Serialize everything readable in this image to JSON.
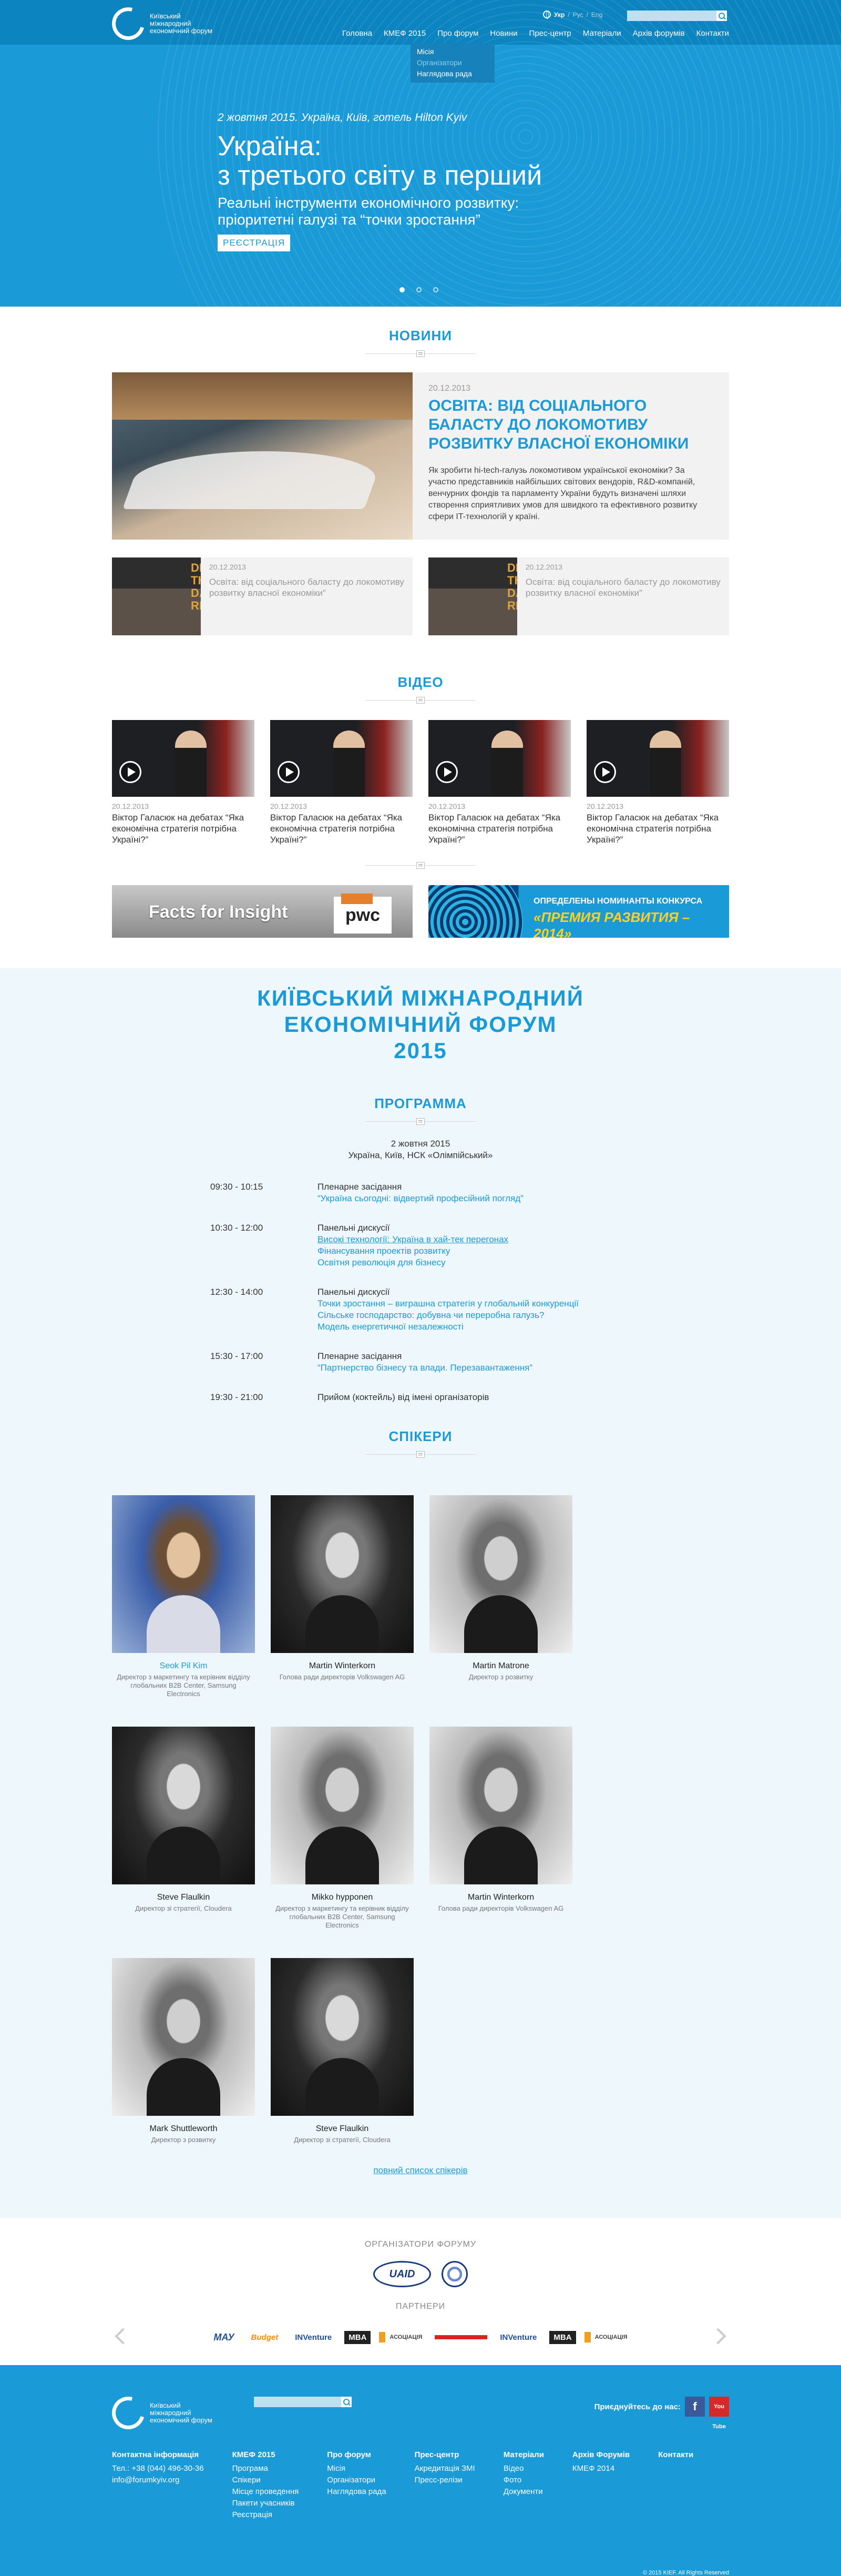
{
  "header": {
    "logo_text": "Київський міжнародний економічний форум",
    "lang_active": "Укр",
    "lang_sep": "/",
    "lang_ru": "Рус",
    "lang_en": "Eng",
    "search_placeholder": "",
    "nav": [
      "Головна",
      "КМЕФ 2015",
      "Про форум",
      "Новини",
      "Прес-центр",
      "Матеріали",
      "Архів форумів",
      "Контакти"
    ],
    "submenu": [
      "Місія",
      "Організатори",
      "Наглядова рада"
    ]
  },
  "hero": {
    "date": "2 жовтня 2015. Україна, Київ, готель Hilton Kyiv",
    "title_1": "Україна:",
    "title_2": "з третього світу в перший",
    "subtitle_1": "Реальні інструменти економічного розвитку:",
    "subtitle_2": "пріоритетні галузі та “точки зростання”",
    "button": "РЕЄСТРАЦІЯ",
    "slides_total": 3,
    "slide_active": 1
  },
  "news": {
    "heading": "НОВИНИ",
    "featured": {
      "date": "20.12.2013",
      "title": "ОСВІТА: ВІД СОЦІАЛЬНОГО БАЛАСТУ ДО ЛОКОМОТИВУ РОЗВИТКУ ВЛАСНОЇ ЕКОНОМІКИ",
      "text": "Як зробити hi-tech-галузь локомотивом української економіки? За участю представників найбільших світових вендорів, R&D-компаній, венчурних фондів та парламенту України будуть визначені шляхи створення сприятливих умов для швидкого та ефективного розвитку сфери IT-технологій у країні."
    },
    "items": [
      {
        "date": "20.12.2013",
        "title": "Освіта: від соціального баласту до локомотиву розвитку власної економіки”",
        "image_text": "DRIVING THE DATA RE"
      },
      {
        "date": "20.12.2013",
        "title": "Освіта: від соціального баласту до локомотиву розвитку власної економіки”",
        "image_text": "DRIVING THE DATA RE"
      }
    ]
  },
  "video": {
    "heading": "ВІДЕО",
    "items": [
      {
        "date": "20.12.2013",
        "title": "Віктор Галасюк на дебатах “Яка економічна стратегія потрібна Україні?”"
      },
      {
        "date": "20.12.2013",
        "title": "Віктор Галасюк на дебатах “Яка економічна стратегія потрібна Україні?”"
      },
      {
        "date": "20.12.2013",
        "title": "Віктор Галасюк на дебатах “Яка економічна стратегія потрібна Україні?”"
      },
      {
        "date": "20.12.2013",
        "title": "Віктор Галасюк на дебатах “Яка економічна стратегія потрібна Україні?”"
      }
    ]
  },
  "banners": {
    "b1_text": "Facts for Insight",
    "b1_logo": "pwc",
    "b2_line1": "ОПРЕДЕЛЕНЫ НОМИНАНТЫ КОНКУРСА",
    "b2_line2": "«ПРЕМИЯ РАЗВИТИЯ – 2014»"
  },
  "forum": {
    "title_1": "КИЇВСЬКИЙ МІЖНАРОДНИЙ",
    "title_2": "ЕКОНОМІЧНИЙ ФОРУМ",
    "year": "2015",
    "program_heading": "ПРОГРАММА",
    "program_date": "2 жовтня 2015",
    "program_place": "Україна, Київ, НСК «Олімпійський»",
    "program": [
      {
        "time": "09:30 - 10:15",
        "kind": "Пленарне засідання",
        "links": [
          "“Україна сьогодні: відвертий професійний погляд”"
        ]
      },
      {
        "time": "10:30 - 12:00",
        "kind": "Панельні дискусії",
        "links": [
          "Високі технології: Україна в хай-тек перегонах",
          "Фінансування проектів розвитку",
          "Освітня революція для бізнесу"
        ]
      },
      {
        "time": "12:30 - 14:00",
        "kind": "Панельні дискусії",
        "links": [
          "Точки зростання – виграшна стратегія у глобальній конкуренції",
          "Сільське господарство: добувна чи переробна галузь?",
          "Модель енергетичної незалежності"
        ]
      },
      {
        "time": "15:30 - 17:00",
        "kind": "Пленарне засідання",
        "links": [
          "“Партнерство бізнесу та влади. Перезавантаження”"
        ]
      },
      {
        "time": "19:30 - 21:00",
        "kind": "Прийом (коктейль) від імені організаторів",
        "links": []
      }
    ],
    "speakers_heading": "СПІКЕРИ",
    "speakers": [
      {
        "name": "Seok Pil Kim",
        "role": "Директор з маркетингу та керівник відділу глобальних B2B Center, Samsung Electronics"
      },
      {
        "name": "Martin Winterkorn",
        "role": "Голова ради директорів Volkswagen AG"
      },
      {
        "name": "Martin Matrone",
        "role": "Директор з розвитку"
      },
      {
        "name": "Steve Flaulkin",
        "role": "Директор зі стратегії, Cloudera"
      },
      {
        "name": "Mikko hypponen",
        "role": "Директор з маркетингу та керівник відділу глобальних B2B Center, Samsung Electronics"
      },
      {
        "name": "Martin Winterkorn",
        "role": "Голова ради директорів Volkswagen AG"
      },
      {
        "name": "Mark Shuttleworth",
        "role": "Директор з розвитку"
      },
      {
        "name": "Steve Flaulkin",
        "role": "Директор зі стратегії, Cloudera"
      }
    ],
    "full_list": "повний список спікерів"
  },
  "orgs": {
    "heading": "ОРГАНІЗАТОРИ ФОРУМУ",
    "uaid": "UAID",
    "partners_heading": "ПАРТНЕРИ",
    "partners": [
      "МАУ",
      "Budget",
      "INVenture",
      "MBA",
      "АСОЦІАЦІЯ",
      "",
      "INVenture",
      "MBA",
      "АСОЦІАЦІЯ"
    ]
  },
  "footer": {
    "logo_text": "Київський міжнародний економічний форум",
    "join": "Приєднуйтесь до нас:",
    "fb": "f",
    "yt": "You Tube",
    "contacts_title": "Контактна інформація",
    "phone": "Тел.: +38 (044) 496-30-36",
    "email": "info@forumkyiv.org",
    "cols": [
      {
        "title": "КМЕФ 2015",
        "links": [
          "Програма",
          "Спікери",
          "Місце проведення",
          "Пакети учасників",
          "Реєстрація"
        ]
      },
      {
        "title": "Про форум",
        "links": [
          "Місія",
          "Організатори",
          "Наглядова рада"
        ]
      },
      {
        "title": "Прес-центр",
        "links": [
          "Акредитація ЗМІ",
          "Пресс-релізи"
        ]
      },
      {
        "title": "Матеріали",
        "links": [
          "Відео",
          "Фото",
          "Документи"
        ]
      },
      {
        "title": "Архів Форумів",
        "links": [
          "КМЕФ 2014"
        ]
      },
      {
        "title": "Контакти",
        "links": []
      }
    ],
    "copyright": "© 2015 KIEF. All Rights Reserved"
  }
}
